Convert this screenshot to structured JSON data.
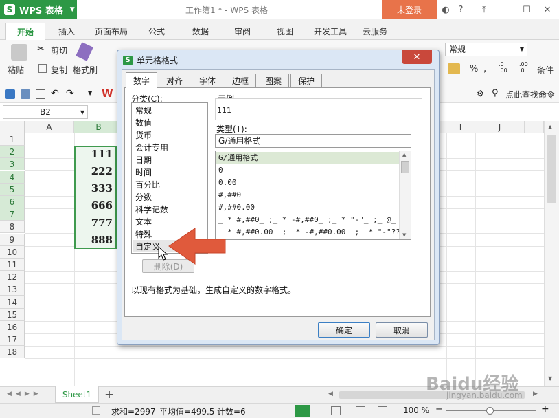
{
  "titlebar": {
    "app_name": "WPS 表格",
    "doc_title": "工作簿1 * - WPS 表格",
    "login_label": "未登录"
  },
  "ribbon_tabs": [
    "开始",
    "插入",
    "页面布局",
    "公式",
    "数据",
    "审阅",
    "视图",
    "开发工具",
    "云服务"
  ],
  "ribbon": {
    "cut_label": "剪切",
    "paste_label": "粘贴",
    "copy_label": "复制",
    "format_painter_label": "格式刷",
    "number_format_value": "常规",
    "percent_symbol": "%",
    "find_command": "点此查找命令",
    "condition_label": "条件"
  },
  "namebox": {
    "value": "B2"
  },
  "columns": [
    "A",
    "B",
    "I",
    "J"
  ],
  "rows": [
    "1",
    "2",
    "3",
    "4",
    "5",
    "6",
    "7",
    "8",
    "9",
    "10",
    "11",
    "12",
    "13",
    "14",
    "15",
    "16",
    "17",
    "18"
  ],
  "cells_b": [
    "111",
    "222",
    "333",
    "666",
    "777",
    "888"
  ],
  "sheetbar": {
    "sheet_name": "Sheet1"
  },
  "statusbar": {
    "sum": "求和=2997",
    "average": "平均值=499.5",
    "count": "计数=6",
    "zoom": "100 %"
  },
  "dialog": {
    "title": "单元格格式",
    "close_symbol": "✕",
    "tabs": [
      "数字",
      "对齐",
      "字体",
      "边框",
      "图案",
      "保护"
    ],
    "category_label": "分类(C):",
    "categories": [
      "常规",
      "数值",
      "货币",
      "会计专用",
      "日期",
      "时间",
      "百分比",
      "分数",
      "科学记数",
      "文本",
      "特殊",
      "自定义"
    ],
    "sample_label": "示例",
    "sample_value": "111",
    "type_label": "类型(T):",
    "type_value": "G/通用格式",
    "formats": [
      "G/通用格式",
      "0",
      "0.00",
      "#,##0",
      "#,##0.00",
      "_ * #,##0_ ;_ * -#,##0_ ;_ * \"-\"_ ;_ @_",
      "_ * #,##0.00_ ;_ * -#,##0.00_ ;_ * \"-\"??…"
    ],
    "delete_label": "删除(D)",
    "description": "以现有格式为基础，生成自定义的数字格式。",
    "ok_label": "确定",
    "cancel_label": "取消"
  },
  "watermark": {
    "text": "Baidu经验",
    "sub": "jingyan.baidu.com"
  },
  "colors": {
    "accent_green": "#2d9845",
    "login_orange": "#e8734a",
    "arrow_red": "#e05a3c"
  }
}
